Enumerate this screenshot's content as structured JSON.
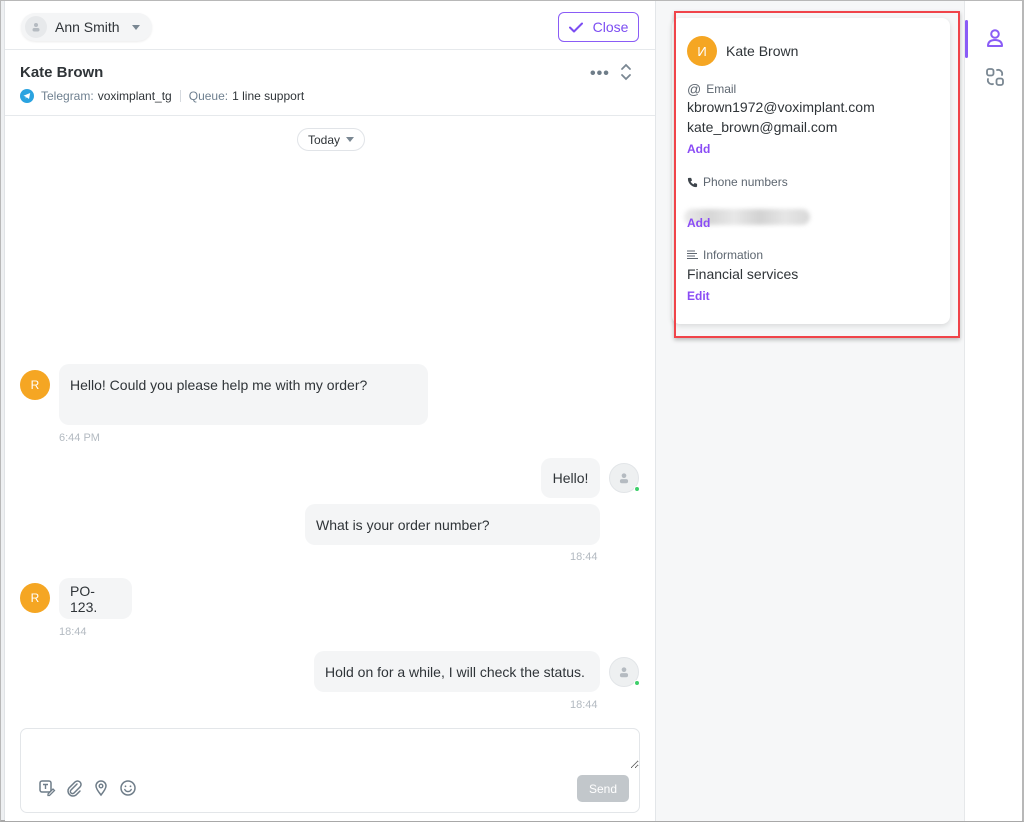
{
  "topbar": {
    "agent_name": "Ann Smith",
    "close_label": "Close"
  },
  "conversation": {
    "title": "Kate Brown",
    "channel_label": "Telegram:",
    "channel_value": "voximplant_tg",
    "queue_label": "Queue:",
    "queue_value": "1 line support",
    "date_filter": "Today"
  },
  "messages": [
    {
      "side": "client",
      "avatar_letter": "R",
      "text": "Hello! Could you please help me with my order?",
      "time": "6:44 PM"
    },
    {
      "side": "operator",
      "text": "Hello!",
      "time": ""
    },
    {
      "side": "operator",
      "text": "What is your order number?",
      "time": "18:44"
    },
    {
      "side": "client",
      "avatar_letter": "R",
      "text": "PO-123.",
      "time": "18:44"
    },
    {
      "side": "operator",
      "text": "Hold on for a while, I will check the status.",
      "time": "18:44"
    }
  ],
  "composer": {
    "value": "",
    "placeholder": "",
    "send_label": "Send"
  },
  "contact_card": {
    "avatar_letter": "И",
    "name": "Kate Brown",
    "email_label": "Email",
    "emails": [
      "kbrown1972@voximplant.com",
      "kate_brown@gmail.com"
    ],
    "email_add_label": "Add",
    "phone_label": "Phone numbers",
    "phone_value_hidden": true,
    "phone_add_label": "Add",
    "info_label": "Information",
    "info_value": "Financial services",
    "info_edit_label": "Edit"
  },
  "rail": {
    "items": [
      {
        "icon": "user-icon",
        "active": true
      },
      {
        "icon": "apps-icon",
        "active": false
      }
    ]
  },
  "colors": {
    "accent": "#8a5cf6",
    "avatar_orange": "#f5a623",
    "online": "#3ecf6a",
    "highlight_border": "#f0444a",
    "telegram": "#2aa3e0"
  }
}
